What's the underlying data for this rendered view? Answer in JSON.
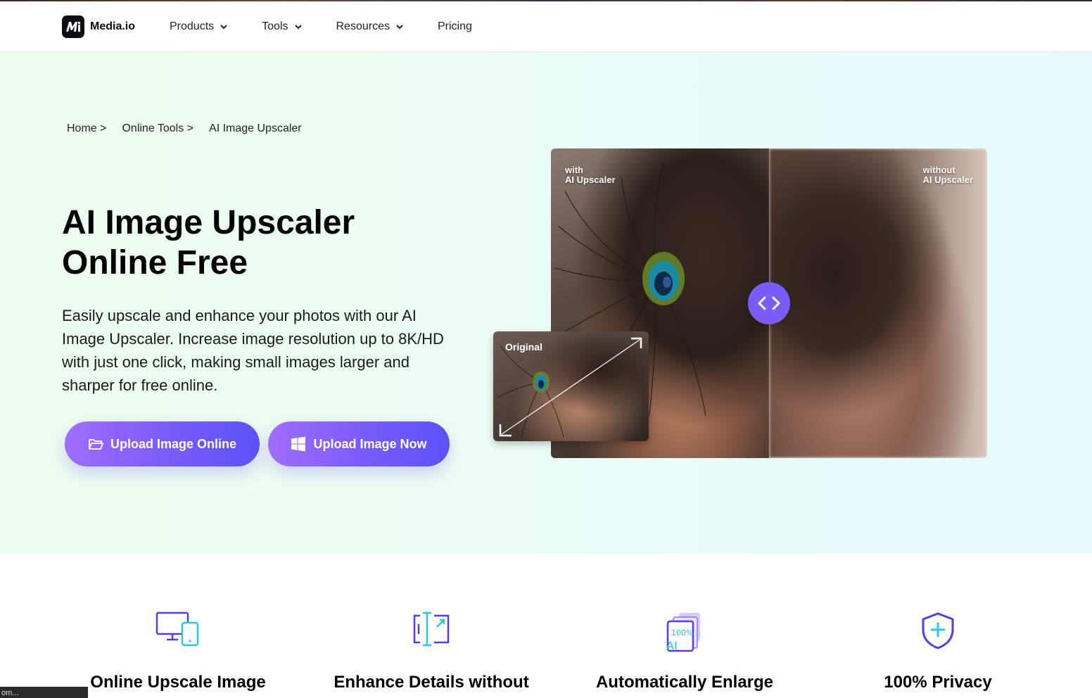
{
  "nav": {
    "brand": "Media.io",
    "logo_text": "M",
    "items": [
      {
        "label": "Products",
        "has_dropdown": true
      },
      {
        "label": "Tools",
        "has_dropdown": true
      },
      {
        "label": "Resources",
        "has_dropdown": true
      },
      {
        "label": "Pricing",
        "has_dropdown": false
      }
    ]
  },
  "breadcrumb": {
    "home": "Home >",
    "online_tools": "Online Tools >",
    "current": "AI Image Upscaler"
  },
  "hero": {
    "title_line1": "AI Image Upscaler",
    "title_line2": "Online Free",
    "description": "Easily upscale and enhance your photos with our AI Image Upscaler. Increase image resolution up to 8K/HD with just one click, making small images larger and sharper for free online.",
    "upload_online_label": "Upload Image Online",
    "upload_now_label": "Upload Image Now"
  },
  "comparison": {
    "with_line1": "with",
    "with_line2": "AI Upscaler",
    "without_line1": "without",
    "without_line2": "AI Upscaler",
    "original_label": "Original"
  },
  "features": [
    {
      "title": "Online Upscale Image",
      "icon": "devices-icon"
    },
    {
      "title": "Enhance Details without",
      "icon": "enhance-icon"
    },
    {
      "title": "Automatically Enlarge",
      "icon": "ai-enlarge-icon"
    },
    {
      "title": "100% Privacy",
      "icon": "shield-icon"
    }
  ],
  "status_bar": "om...",
  "colors": {
    "accent": "#7a5cf8",
    "button_gradient_start": "#a06dfb",
    "button_gradient_end": "#5a52f6",
    "icon_teal": "#2ec6d8",
    "icon_purple": "#5a3ae6"
  }
}
